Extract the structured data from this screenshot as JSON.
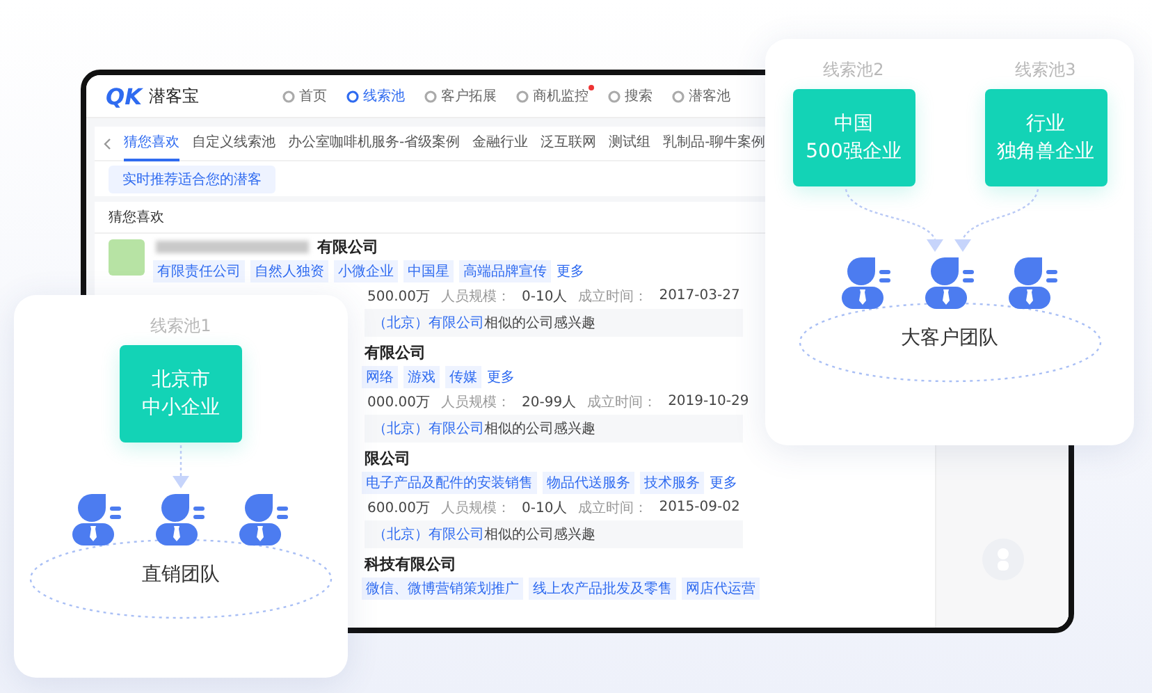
{
  "app": {
    "logo_mark": "QK",
    "name": "潜客宝"
  },
  "nav": [
    {
      "label": "首页",
      "selected": false,
      "alert": false
    },
    {
      "label": "线索池",
      "selected": true,
      "alert": false
    },
    {
      "label": "客户拓展",
      "selected": false,
      "alert": false
    },
    {
      "label": "商机监控",
      "selected": false,
      "alert": true
    },
    {
      "label": "搜索",
      "selected": false,
      "alert": false
    },
    {
      "label": "潜客池",
      "selected": false,
      "alert": false
    }
  ],
  "tabs": [
    {
      "label": "猜您喜欢",
      "selected": true
    },
    {
      "label": "自定义线索池",
      "selected": false
    },
    {
      "label": "办公室咖啡机服务-省级案例",
      "selected": false
    },
    {
      "label": "金融行业",
      "selected": false
    },
    {
      "label": "泛互联网",
      "selected": false
    },
    {
      "label": "测试组",
      "selected": false
    },
    {
      "label": "乳制品-聊牛案例",
      "selected": false
    }
  ],
  "recommend_button": "实时推荐适合您的潜客",
  "section_title": "猜您喜欢",
  "companies": [
    {
      "kind": "full",
      "name": "有限公司",
      "tags": [
        {
          "kind": "tag",
          "label": "有限责任公司"
        },
        {
          "kind": "tag",
          "label": "自然人独资"
        },
        {
          "kind": "tag",
          "label": "小微企业"
        },
        {
          "kind": "tag",
          "label": "中国星"
        },
        {
          "kind": "tag",
          "label": "高端品牌宣传"
        },
        {
          "kind": "more",
          "label": "更多"
        }
      ],
      "capital": "500.00万",
      "staff_label": "人员规模：",
      "staff": "0-10人",
      "founded_label": "成立时间：",
      "founded": "2017-03-27",
      "note_link": "（北京）有限公司",
      "note_text": "相似的公司感兴趣"
    },
    {
      "kind": "covered",
      "name": "有限公司",
      "tags": [
        {
          "kind": "tag",
          "label": "网络"
        },
        {
          "kind": "tag",
          "label": "游戏"
        },
        {
          "kind": "tag",
          "label": "传媒"
        },
        {
          "kind": "more",
          "label": "更多"
        }
      ],
      "capital": "000.00万",
      "staff_label": "人员规模：",
      "staff": "20-99人",
      "founded_label": "成立时间：",
      "founded": "2019-10-29",
      "note_link": "（北京）有限公司",
      "note_text": "相似的公司感兴趣"
    },
    {
      "kind": "covered",
      "name": "限公司",
      "tags": [
        {
          "kind": "tag",
          "label": "电子产品及配件的安装销售"
        },
        {
          "kind": "tag",
          "label": "物品代送服务"
        },
        {
          "kind": "tag",
          "label": "技术服务"
        },
        {
          "kind": "more",
          "label": "更多"
        }
      ],
      "capital": "600.00万",
      "staff_label": "人员规模：",
      "staff": "0-10人",
      "founded_label": "成立时间：",
      "founded": "2015-09-02",
      "note_link": "（北京）有限公司",
      "note_text": "相似的公司感兴趣"
    },
    {
      "kind": "covered",
      "name": "科技有限公司",
      "tags": [
        {
          "kind": "tag",
          "label": "微信、微博营销策划推广"
        },
        {
          "kind": "tag",
          "label": "线上农产品批发及零售"
        },
        {
          "kind": "tag",
          "label": "网店代运营"
        }
      ]
    }
  ],
  "lead_groups": [
    {
      "pools": [
        {
          "label": "线索池1",
          "segment_lines": [
            "北京市",
            "中小企业"
          ]
        }
      ],
      "team": "直销团队"
    },
    {
      "pools": [
        {
          "label": "线索池2",
          "segment_lines": [
            "中国",
            "500强企业"
          ]
        },
        {
          "label": "线索池3",
          "segment_lines": [
            "行业",
            "独角兽企业"
          ]
        }
      ],
      "team": "大客户团队"
    }
  ]
}
